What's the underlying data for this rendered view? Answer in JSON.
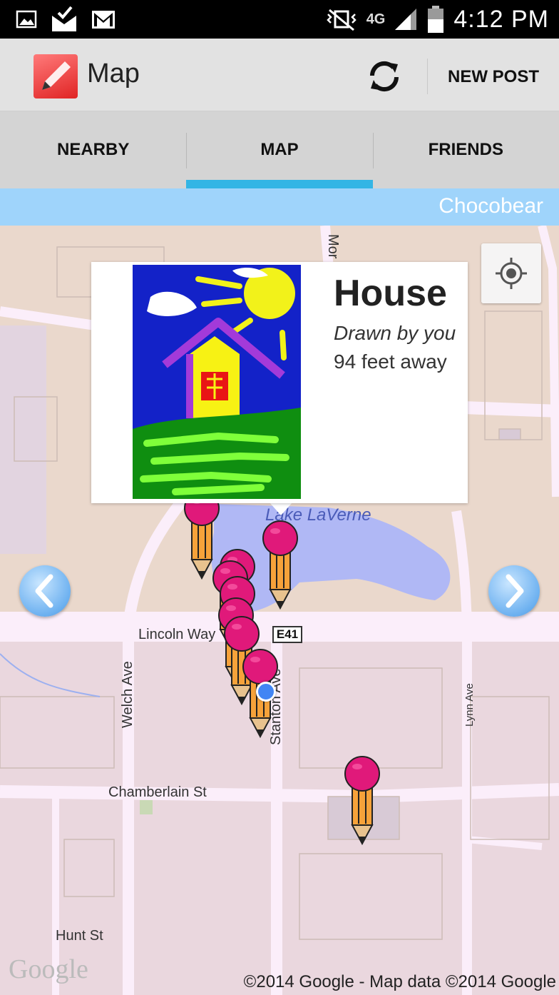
{
  "status_bar": {
    "time": "4:12 PM",
    "network": "4G",
    "icons": [
      "gallery-icon",
      "mail-check-icon",
      "gmail-icon",
      "vibrate-mute-icon",
      "network-4g-icon",
      "signal-icon",
      "battery-icon"
    ]
  },
  "action_bar": {
    "title": "Map",
    "new_post_label": "NEW POST",
    "refresh_icon": "refresh-icon",
    "app_icon": "pencil-app-icon"
  },
  "tabs": [
    {
      "label": "NEARBY",
      "active": false
    },
    {
      "label": "MAP",
      "active": true
    },
    {
      "label": "FRIENDS",
      "active": false
    }
  ],
  "user": {
    "name": "Chocobear"
  },
  "map": {
    "labels": {
      "lake": "Lake LaVerne",
      "lincoln": "Lincoln Way",
      "highway": "E41",
      "welch": "Welch Ave",
      "stanton": "Stanton Ave",
      "lynn": "Lynn Ave",
      "chamberlain": "Chamberlain St",
      "hunt": "Hunt St",
      "morrill": "Mor"
    },
    "google_logo": "Google",
    "copyright": "©2014 Google - Map data ©2014 Google"
  },
  "popup": {
    "title": "House",
    "author": "Drawn by you",
    "distance": "94 feet away"
  },
  "colors": {
    "tab_indicator": "#33b5e5",
    "user_bar": "#9fd4fb",
    "pin_head": "#e0197a",
    "my_location": "#4285f4"
  }
}
